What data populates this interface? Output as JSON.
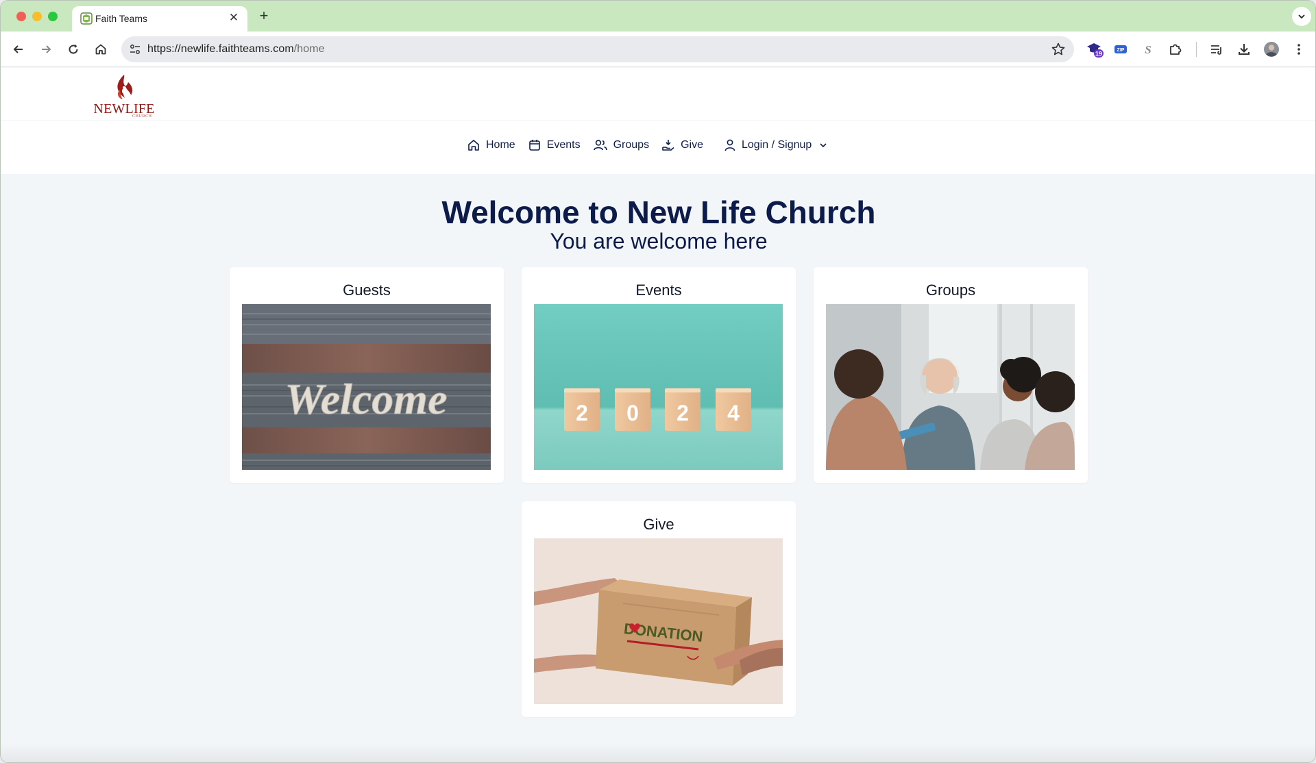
{
  "browser": {
    "tab_title": "Faith Teams",
    "url_host": "https://newlife.faithteams.com",
    "url_path": "/home",
    "extension_badge": "19",
    "zip_label": "ZIP",
    "s_label": "S"
  },
  "site": {
    "logo_text": "NEWLIFE",
    "logo_sub": "CHURCH",
    "nav": [
      {
        "label": "Home"
      },
      {
        "label": "Events"
      },
      {
        "label": "Groups"
      },
      {
        "label": "Give"
      }
    ],
    "login_label": "Login / Signup"
  },
  "hero": {
    "title": "Welcome to New Life Church",
    "subtitle": "You are welcome here"
  },
  "cards": [
    {
      "title": "Guests",
      "image_text": "Welcome"
    },
    {
      "title": "Events",
      "image_text": [
        "2",
        "0",
        "2",
        "4"
      ]
    },
    {
      "title": "Groups"
    },
    {
      "title": "Give",
      "image_text": "DONATION"
    }
  ],
  "colors": {
    "navy": "#0d1b4b",
    "brand_red": "#8a1a17",
    "tabstrip": "#c9e8bf",
    "page_bg": "#f3f6f9"
  }
}
